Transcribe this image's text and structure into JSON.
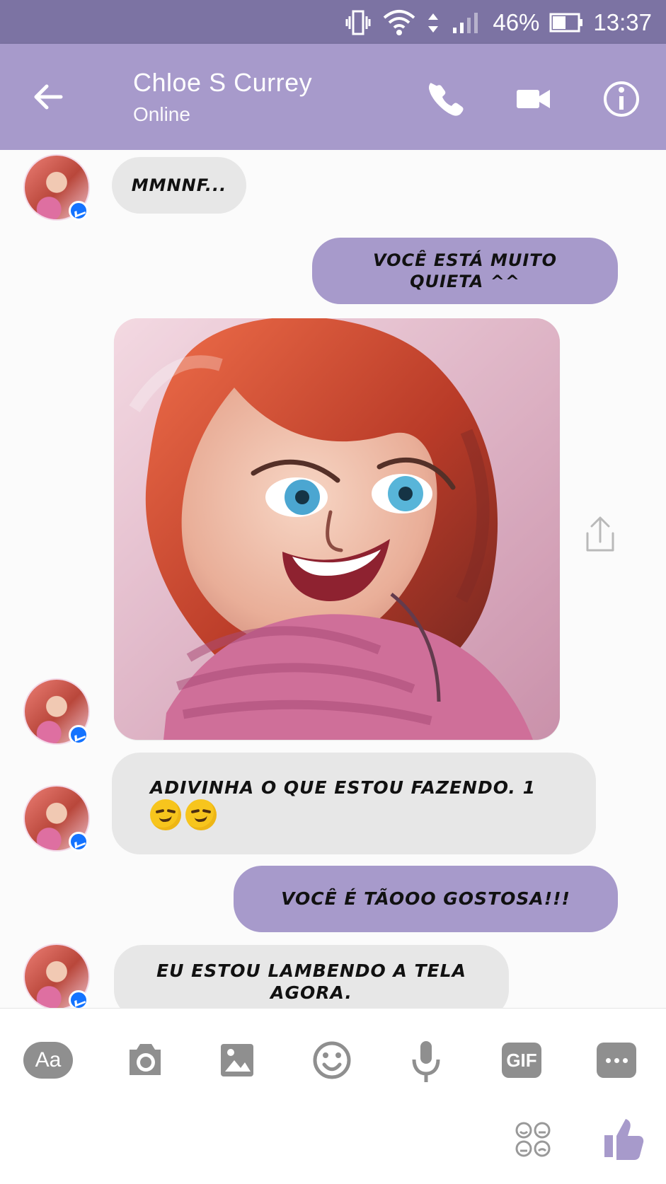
{
  "status": {
    "battery": "46%",
    "time": "13:37",
    "icons": [
      "vibrate-icon",
      "wifi-icon",
      "data-arrows-icon",
      "signal-icon",
      "battery-icon"
    ]
  },
  "header": {
    "contact_name": "Chloe S Currey",
    "presence": "Online",
    "actions": [
      "back-arrow-icon",
      "phone-icon",
      "video-camera-icon",
      "info-icon"
    ],
    "color": "#a79acb"
  },
  "messages": [
    {
      "from": "incoming",
      "text": "MMNNF..."
    },
    {
      "from": "outgoing",
      "text": "VOCÊ ESTÁ MUITO QUIETA ^^"
    },
    {
      "from": "incoming",
      "type": "image",
      "image_label": "Illustrated selfie"
    },
    {
      "from": "incoming",
      "text": "ADIVINHA O QUE ESTOU FAZENDO. 1",
      "emoji": [
        "smirking-face",
        "smirking-face"
      ]
    },
    {
      "from": "outgoing",
      "text": "VOCÊ É TÃOOO GOSTOSA!!!"
    },
    {
      "from": "incoming",
      "text": "EU ESTOU LAMBENDO A TELA AGORA."
    }
  ],
  "composer": {
    "aa": "Aa",
    "gif": "GIF",
    "tools": [
      "text-mode-button",
      "camera-icon",
      "image-gallery-icon",
      "emoji-icon",
      "microphone-icon",
      "gif-button",
      "more-icon"
    ],
    "extra_icons": [
      "sticker-faces-icon",
      "thumbs-up-icon"
    ]
  }
}
